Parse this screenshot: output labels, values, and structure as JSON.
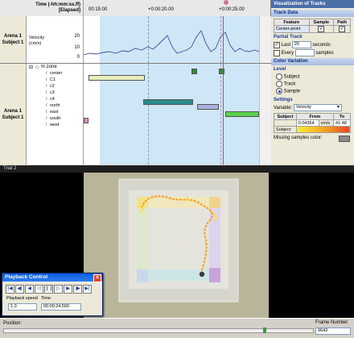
{
  "timeline": {
    "time_header": "Time (-hh:mm:ss.ff)",
    "time_header_sub": "[Elapsed]",
    "ticks": [
      "00:15:00",
      "+0:00:20.00",
      "+0:00:25.00"
    ],
    "arena_label_1": "Arena 1",
    "subject_label_1": "Subject 1",
    "arena_label_2": "Arena 1",
    "subject_label_2": "Subject 1",
    "velocity_label": "Velocity",
    "velocity_unit": "(cm/s)",
    "y_ticks": [
      "20",
      "10",
      "0"
    ],
    "zone_group": "In zone",
    "zones": [
      "center",
      "C1",
      "c2",
      "c3",
      "c4",
      "north",
      "east",
      "south",
      "west"
    ]
  },
  "panel": {
    "title": "Visualization of Tracks",
    "track_data": "Track Data",
    "table_headers": [
      "Feature",
      "Sample",
      "Path"
    ],
    "feature_name": "Center-point",
    "partial_track": "Partial Track",
    "last_label": "Last",
    "last_value": "20",
    "last_unit": "seconds",
    "every_label": "Every",
    "every_unit": "samples",
    "color_variation": "Color Variation",
    "level_label": "Level",
    "level_options": [
      "Subject",
      "Track",
      "Sample"
    ],
    "selected_level": "Sample",
    "settings": "Settings",
    "variable_label": "Variable:",
    "variable_value": "Velocity",
    "range_headers": [
      "Subject",
      "From",
      "To"
    ],
    "range_from": "0.04364",
    "range_unit": "cm/s",
    "range_to": "41.48",
    "range_row_label": "Subject",
    "missing_label": "Missing samples color:"
  },
  "video": {
    "title": "Trial     2"
  },
  "playback": {
    "title": "Playback Control",
    "speed_label": "Playback speed",
    "speed_value": "1.0",
    "time_label": "Time",
    "time_value": "00:00:24.560"
  },
  "status": {
    "position_label": "Position:",
    "frame_label": "Frame Number",
    "frame_value": "9643"
  },
  "colors": {
    "accent": "#4a6ea8",
    "track_path": "#ff9a1a",
    "cursor_line": "#d04060"
  }
}
